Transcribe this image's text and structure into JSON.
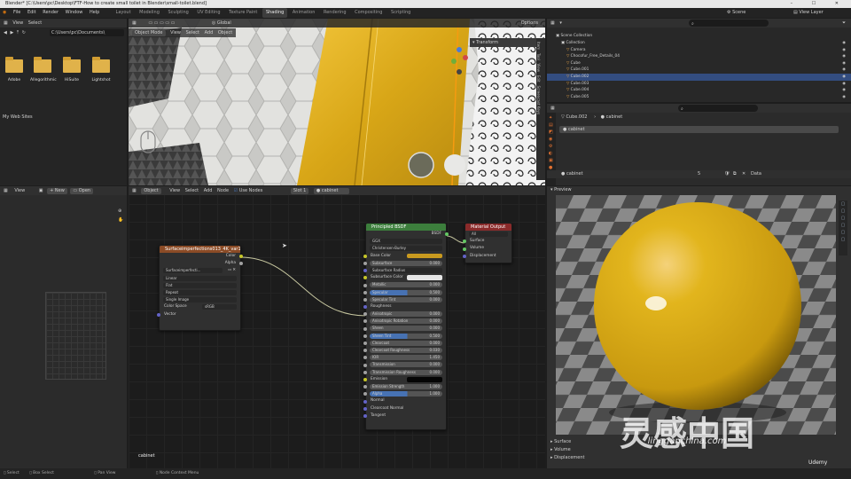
{
  "window": {
    "title": "Blender* [C:\\Users\\pc\\Desktop\\FTF-How to create small toilet in Blender\\small-toilet.blend]",
    "controls": "– ☐ ✕"
  },
  "menubar": {
    "menus": [
      "File",
      "Edit",
      "Render",
      "Window",
      "Help"
    ],
    "workspaces": [
      "Layout",
      "Modeling",
      "Sculpting",
      "UV Editing",
      "Texture Paint",
      "Shading",
      "Animation",
      "Rendering",
      "Compositing",
      "Scripting"
    ],
    "active_workspace": "Shading",
    "scene": "Scene",
    "view_layer": "View Layer"
  },
  "filebrowser": {
    "menus": [
      "View",
      "Select"
    ],
    "path": "C:\\Users\\pc\\Documents\\",
    "folders": [
      "Adobe",
      "Allegorithmic",
      "HiSuite",
      "Lightshot"
    ],
    "extra_item": "My Web Sites"
  },
  "viewport": {
    "mode": "Object Mode",
    "menus": [
      "View",
      "Select",
      "Add",
      "Object"
    ],
    "transform_orientation": "Global",
    "options": "Options",
    "n_panel_tab": "Transform",
    "side_tabs": [
      "Item",
      "Tool",
      "View",
      "Edit",
      "Screencast Keys"
    ]
  },
  "image_editor": {
    "view_menu": "View",
    "new_button": "New",
    "open_button": "Open"
  },
  "node_editor": {
    "editor_type": "Object",
    "menus": [
      "View",
      "Select",
      "Add",
      "Node"
    ],
    "use_nodes": "Use Nodes",
    "slot": "Slot 1",
    "material": "cabinet",
    "label_bottom": "cabinet",
    "image_node": {
      "title": "Surfaceimperfections013_4K_var1.jpg",
      "outputs": [
        "Color",
        "Alpha"
      ],
      "image_name": "Surfaceimperfecti...",
      "interpolation": "Linear",
      "projection": "Flat",
      "extension": "Repeat",
      "source": "Single Image",
      "color_space_label": "Color Space",
      "color_space": "sRGB",
      "input": "Vector"
    },
    "bsdf_node": {
      "title": "Principled BSDF",
      "output": "BSDF",
      "distribution": "GGX",
      "subsurface_method": "Christensen-Burley",
      "rows": [
        {
          "label": "Base Color",
          "type": "color",
          "value": "",
          "color": "#c99a1f"
        },
        {
          "label": "Subsurface",
          "type": "slider",
          "value": "0.000"
        },
        {
          "label": "Subsurface Radius",
          "type": "dropdown",
          "value": ""
        },
        {
          "label": "Subsurface Color",
          "type": "color",
          "value": "",
          "color": "#e6e6e6"
        },
        {
          "label": "Metallic",
          "type": "slider",
          "value": "0.000"
        },
        {
          "label": "Specular",
          "type": "blue",
          "value": "0.500"
        },
        {
          "label": "Specular Tint",
          "type": "slider",
          "value": "0.000"
        },
        {
          "label": "Roughness",
          "type": "plain",
          "value": ""
        },
        {
          "label": "Anisotropic",
          "type": "slider",
          "value": "0.000"
        },
        {
          "label": "Anisotropic Rotation",
          "type": "slider",
          "value": "0.000"
        },
        {
          "label": "Sheen",
          "type": "slider",
          "value": "0.000"
        },
        {
          "label": "Sheen Tint",
          "type": "blue",
          "value": "0.500"
        },
        {
          "label": "Clearcoat",
          "type": "slider",
          "value": "0.000"
        },
        {
          "label": "Clearcoat Roughness",
          "type": "slider",
          "value": "0.030"
        },
        {
          "label": "IOR",
          "type": "slider",
          "value": "1.450"
        },
        {
          "label": "Transmission",
          "type": "slider",
          "value": "0.000"
        },
        {
          "label": "Transmission Roughness",
          "type": "slider",
          "value": "0.000"
        },
        {
          "label": "Emission",
          "type": "color",
          "value": "",
          "color": "#050505"
        },
        {
          "label": "Emission Strength",
          "type": "slider",
          "value": "1.000"
        },
        {
          "label": "Alpha",
          "type": "blue",
          "value": "1.000"
        },
        {
          "label": "Normal",
          "type": "plain",
          "value": ""
        },
        {
          "label": "Clearcoat Normal",
          "type": "plain",
          "value": ""
        },
        {
          "label": "Tangent",
          "type": "plain",
          "value": ""
        }
      ]
    },
    "output_node": {
      "title": "Material Output",
      "target": "All",
      "inputs": [
        "Surface",
        "Volume",
        "Displacement"
      ]
    }
  },
  "outliner": {
    "root": "Scene Collection",
    "items": [
      {
        "label": "Collection",
        "indent": 1,
        "selected": false
      },
      {
        "label": "Camera",
        "indent": 2,
        "selected": false
      },
      {
        "label": "Chocofur_Free_Details_04",
        "indent": 2,
        "selected": false
      },
      {
        "label": "Cube",
        "indent": 2,
        "selected": false
      },
      {
        "label": "Cube.001",
        "indent": 2,
        "selected": false
      },
      {
        "label": "Cube.002",
        "indent": 2,
        "selected": true
      },
      {
        "label": "Cube.003",
        "indent": 2,
        "selected": false
      },
      {
        "label": "Cube.004",
        "indent": 2,
        "selected": false
      },
      {
        "label": "Cube.005",
        "indent": 2,
        "selected": false
      }
    ]
  },
  "properties": {
    "object": "Cube.002",
    "material": "cabinet",
    "slot": "cabinet",
    "material_field": "cabinet",
    "users": "5",
    "data": "Data"
  },
  "preview": {
    "label": "Preview",
    "sections": [
      "Surface",
      "Volume",
      "Displacement"
    ],
    "watermark_text": "灵感中国",
    "watermark_url": "lingganchina.com",
    "brand": "Udemy"
  },
  "statusbar": {
    "items": [
      "Select",
      "Box Select",
      "Pan View",
      "Node Context Menu"
    ]
  },
  "colors": {
    "accent_blue": "#4772b3",
    "material_yellow": "#e0b21a",
    "selection": "#334d80"
  }
}
